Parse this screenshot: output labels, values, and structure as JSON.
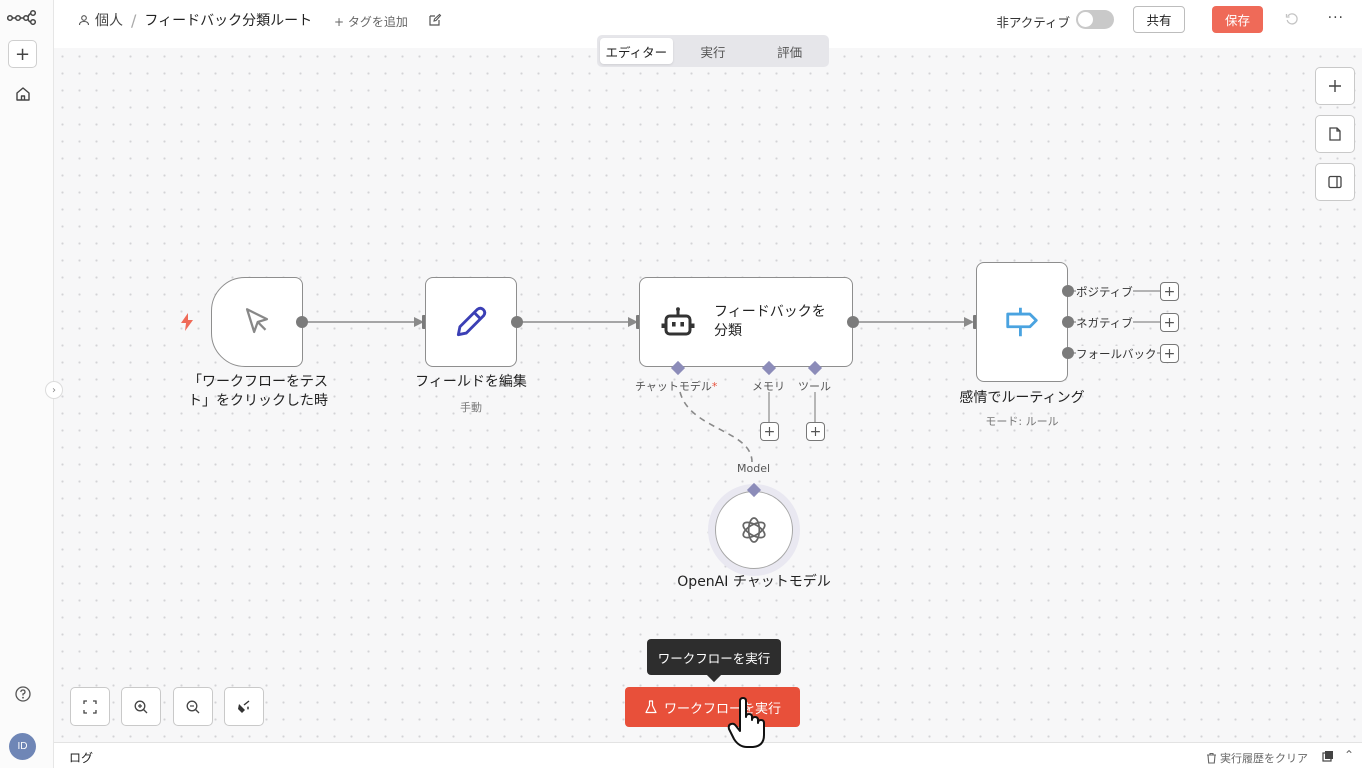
{
  "app": {
    "breadcrumb": {
      "project": "個人",
      "separator": "/",
      "workflow_name": "フィードバック分類ルート"
    },
    "add_tag": "+ タグを追加",
    "inactive_label": "非アクティブ",
    "share": "共有",
    "save": "保存",
    "more": "···",
    "avatar_initials": "ID"
  },
  "tabs": [
    {
      "label": "エディター",
      "active": true
    },
    {
      "label": "実行",
      "active": false
    },
    {
      "label": "評価",
      "active": false
    }
  ],
  "nodes": {
    "trigger": {
      "label": "「ワークフローをテスト」をクリックした時",
      "line1": "「ワークフローをテス",
      "line2": "ト」をクリックした時"
    },
    "edit_fields": {
      "label": "フィールドを編集",
      "sub": "手動"
    },
    "classifier": {
      "label_line1": "フィードバックを",
      "label_line2": "分類",
      "ports": {
        "chat_model": "チャットモデル",
        "required_mark": "*",
        "memory": "メモリ",
        "tool": "ツール"
      }
    },
    "router": {
      "label": "感情でルーティング",
      "sub": "モード: ルール",
      "outputs": [
        "ポジティブ",
        "ネガティブ",
        "フォールバック"
      ]
    },
    "openai": {
      "label": "OpenAI チャットモデル",
      "port": "Model"
    }
  },
  "run": {
    "button": "ワークフローを実行",
    "tooltip": "ワークフローを実行"
  },
  "log": {
    "title": "ログ",
    "clear": "実行履歴をクリア"
  },
  "colors": {
    "accent": "#e8503a",
    "save": "#ef6a58",
    "edit_icon": "#3b3fb5",
    "router_icon": "#4aa3e0",
    "trigger_bolt": "#ef6a58"
  }
}
